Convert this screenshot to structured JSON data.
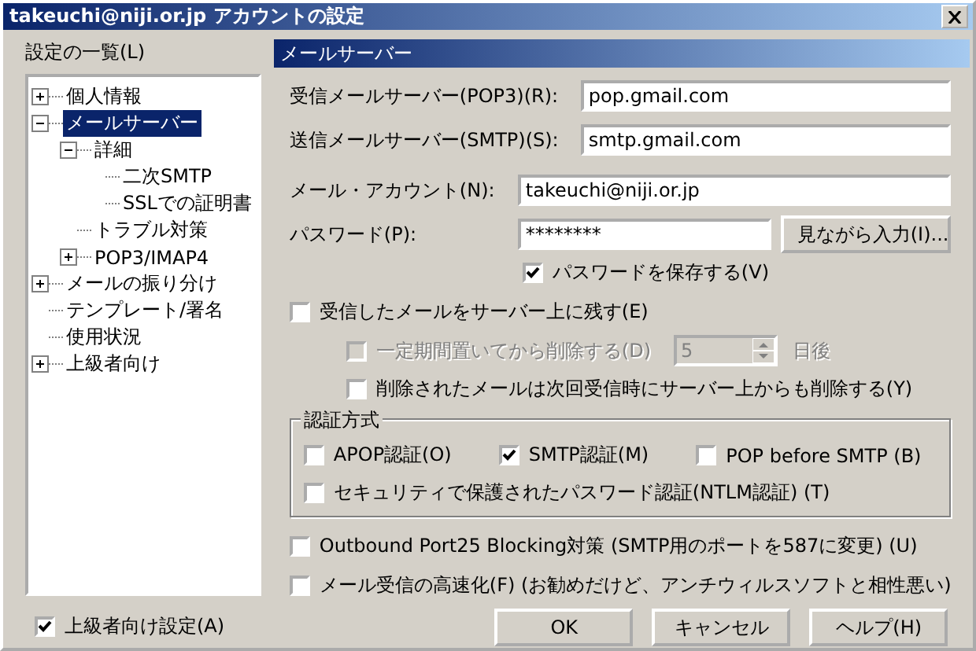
{
  "window": {
    "title": "takeuchi@niji.or.jp アカウントの設定"
  },
  "settings_list": {
    "label": "設定の一覧(L)",
    "tree": [
      {
        "label": "個人情報",
        "expanded": false,
        "selected": false
      },
      {
        "label": "メールサーバー",
        "expanded": true,
        "selected": true,
        "children": [
          {
            "label": "詳細",
            "expanded": true,
            "selected": false,
            "children": [
              {
                "label": "二次SMTP",
                "selected": false
              },
              {
                "label": "SSLでの証明書",
                "selected": false
              }
            ]
          },
          {
            "label": "トラブル対策",
            "selected": false
          },
          {
            "label": "POP3/IMAP4",
            "expanded": false,
            "selected": false
          }
        ]
      },
      {
        "label": "メールの振り分け",
        "expanded": false,
        "selected": false
      },
      {
        "label": "テンプレート/署名",
        "selected": false
      },
      {
        "label": "使用状況",
        "selected": false
      },
      {
        "label": "上級者向け",
        "expanded": false,
        "selected": false
      }
    ]
  },
  "section_header": "メールサーバー",
  "servers": [
    {
      "label": "受信メールサーバー(POP3)(R):",
      "value": "pop.gmail.com"
    },
    {
      "label": "送信メールサーバー(SMTP)(S):",
      "value": "smtp.gmail.com"
    }
  ],
  "account": {
    "label": "メール・アカウント(N):",
    "value": "takeuchi@niji.or.jp"
  },
  "password": {
    "label": "パスワード(P):",
    "value": "********",
    "button": "見ながら入力(I)..."
  },
  "save_password": {
    "label": "パスワードを保存する(V)",
    "checked": true
  },
  "leave_on_server": {
    "label": "受信したメールをサーバー上に残す(E)",
    "checked": false
  },
  "delete_after": {
    "label": "一定期間置いてから削除する(D)",
    "checked": false,
    "disabled": true,
    "days": "5",
    "unit": "日後"
  },
  "delete_when_deleted": {
    "label": "削除されたメールは次回受信時にサーバー上からも削除する(Y)",
    "checked": false
  },
  "auth": {
    "title": "認証方式",
    "options": [
      {
        "label": "APOP認証(O)",
        "checked": false
      },
      {
        "label": "SMTP認証(M)",
        "checked": true
      },
      {
        "label": "POP before SMTP (B)",
        "checked": false
      },
      {
        "label": "セキュリティで保護されたパスワード認証(NTLM認証) (T)",
        "checked": false
      }
    ]
  },
  "outbound": {
    "label": "Outbound Port25 Blocking対策 (SMTP用のポートを587に変更) (U)",
    "checked": false
  },
  "fast_receive": {
    "label": "メール受信の高速化(F) (お勧めだけど、アンチウィルスソフトと相性悪い)",
    "checked": false
  },
  "advanced": {
    "label": "上級者向け設定(A)",
    "checked": true
  },
  "buttons": [
    "OK",
    "キャンセル",
    "ヘルプ(H)"
  ]
}
